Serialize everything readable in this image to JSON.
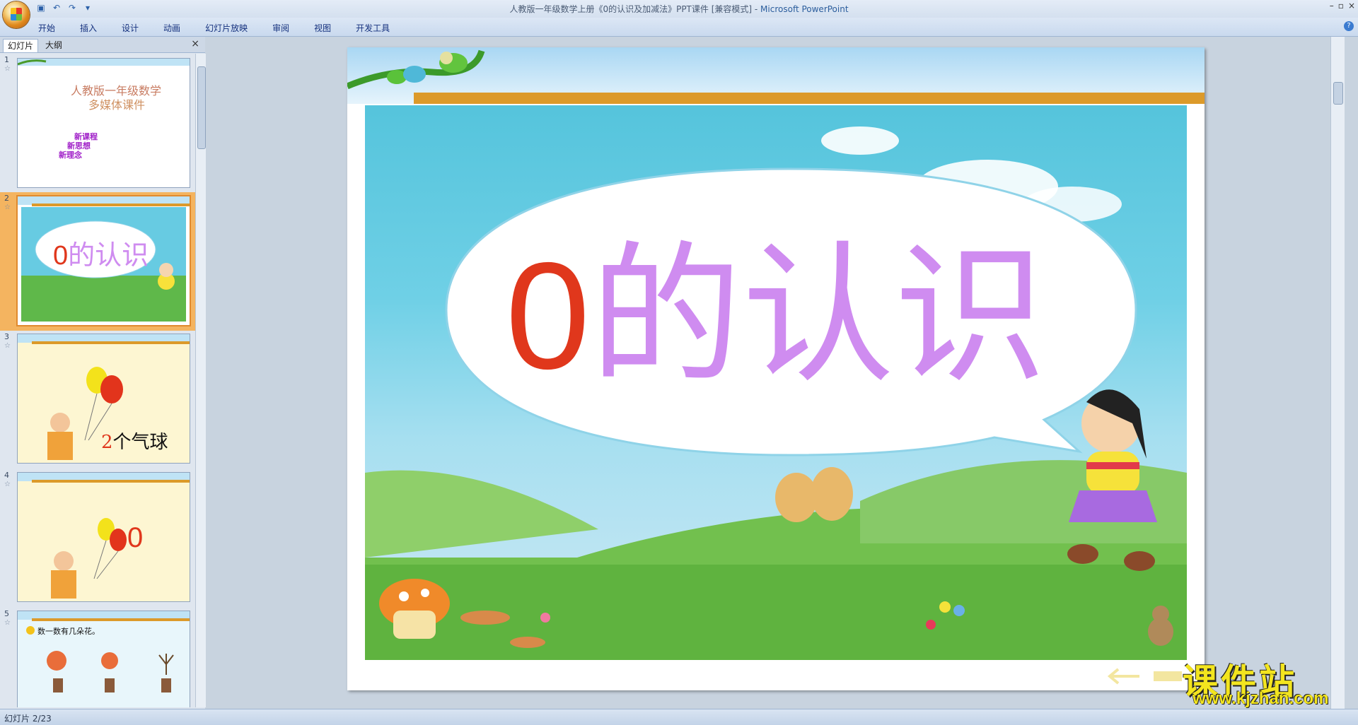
{
  "window": {
    "title": "人教版一年级数学上册《0的认识及加减法》PPT课件 [兼容模式] -",
    "app_name": "Microsoft PowerPoint"
  },
  "quick_access": {
    "icons": [
      "save-icon",
      "undo-icon",
      "redo-icon",
      "customize-icon"
    ]
  },
  "ribbon": {
    "tabs": [
      "开始",
      "插入",
      "设计",
      "动画",
      "幻灯片放映",
      "审阅",
      "视图",
      "开发工具"
    ]
  },
  "left_pane": {
    "tab_slides": "幻灯片",
    "tab_outline": "大纲",
    "close": "×",
    "slides": [
      {
        "num": "1",
        "line1": "人教版一年级数学",
        "line2": "多媒体课件",
        "sub": [
          "新课程",
          "新思想",
          "新理念"
        ]
      },
      {
        "num": "2",
        "zero": "0",
        "title_rest": "的认识"
      },
      {
        "num": "3",
        "num_text": "2",
        "text_rest": "个气球"
      },
      {
        "num": "4",
        "zero": "0"
      },
      {
        "num": "5",
        "label": "数一数有几朵花。"
      }
    ]
  },
  "slide": {
    "zero": "0",
    "title_rest": "的认识"
  },
  "status": {
    "text": "幻灯片 2/23"
  },
  "watermark": {
    "cn": "课件站",
    "url": "www.kjzhan.com"
  },
  "colors": {
    "accent_orange": "#dc9a2a",
    "title_red": "#e0371c",
    "title_purple": "#cf8cf0"
  }
}
